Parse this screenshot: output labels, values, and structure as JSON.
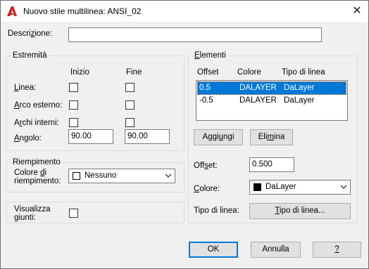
{
  "window": {
    "title": "Nuovo stile multilinea: ANSI_02",
    "icon": "autocad-logo-icon",
    "close_glyph": "✕",
    "accent_color": "#0078d7",
    "app_icon_color": "#d0201a"
  },
  "description": {
    "label": "Descrizione:",
    "value": ""
  },
  "estremita": {
    "title": "Estremità",
    "col_inizio": "Inizio",
    "col_fine": "Fine",
    "rows": [
      {
        "label": "Linea:",
        "inizio": false,
        "fine": false
      },
      {
        "label": "Arco esterno:",
        "inizio": false,
        "fine": false
      },
      {
        "label": "Archi interni:",
        "inizio": false,
        "fine": false
      }
    ],
    "angolo": {
      "label": "Angolo:",
      "inizio": "90.00",
      "fine": "90.00"
    }
  },
  "riempimento": {
    "title": "Riempimento",
    "colore_label_1": "Colore di",
    "colore_label_2": "riempimento:",
    "colore_value": "Nessuno"
  },
  "visualizza": {
    "label_1": "Visualizza",
    "label_2": "giunti:",
    "checked": false
  },
  "elementi": {
    "title": "Elementi",
    "headers": [
      "Offset",
      "Colore",
      "Tipo di linea"
    ],
    "rows": [
      {
        "offset": "0.5",
        "colore": "DALAYER",
        "tipo": "DaLayer",
        "selected": true
      },
      {
        "offset": "-0.5",
        "colore": "DALAYER",
        "tipo": "DaLayer",
        "selected": false
      }
    ],
    "aggiungi": "Aggiungi",
    "elimina": "Elimina",
    "offset_label": "Offset:",
    "offset_value": "0.500",
    "colore_label": "Colore:",
    "colore_value": "DaLayer",
    "tipo_label": "Tipo di linea:",
    "tipo_button": "Tipo di linea..."
  },
  "footer": {
    "ok": "OK",
    "annulla": "Annulla",
    "help": "?"
  }
}
